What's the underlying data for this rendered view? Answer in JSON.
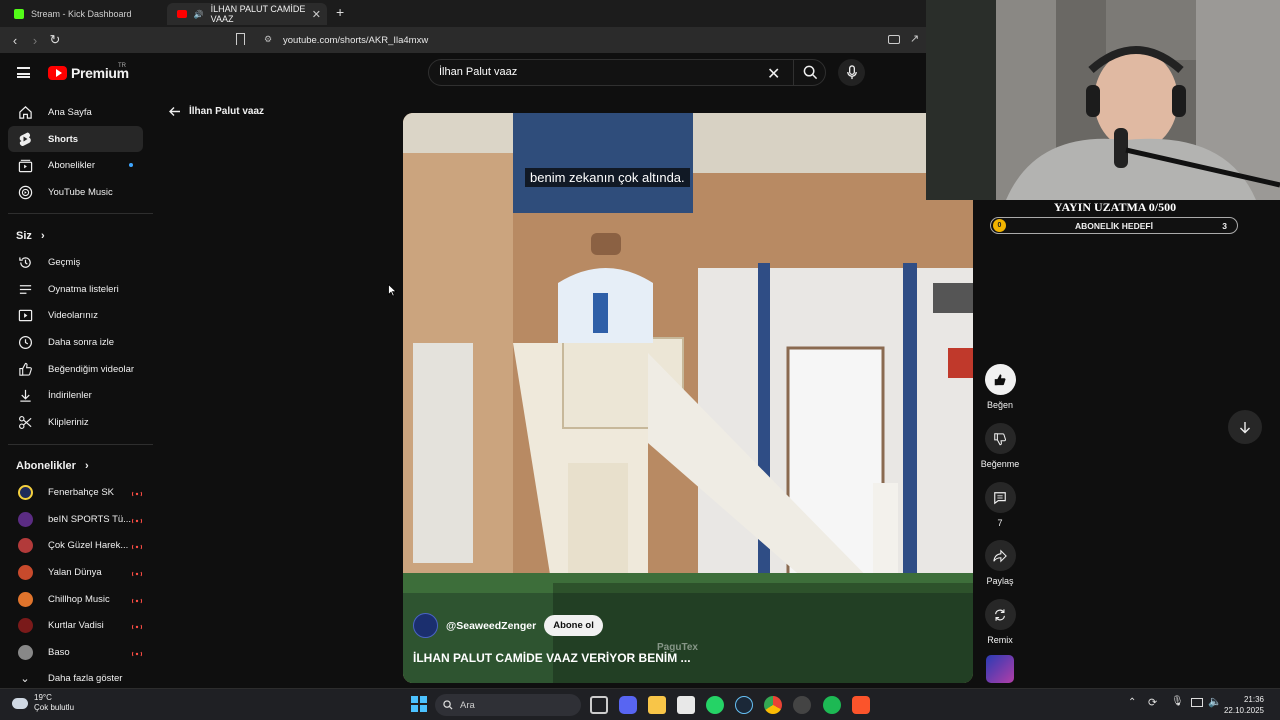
{
  "browser": {
    "tabs": [
      {
        "title": "Stream - Kick Dashboard",
        "active": false
      },
      {
        "title": "İLHAN PALUT CAMİDE VAAZ",
        "active": true
      }
    ],
    "url": "youtube.com/shorts/AKR_Ila4mxw"
  },
  "header": {
    "brand": "Premium",
    "brand_sup": "TR",
    "search_value": "İlhan Palut vaaz"
  },
  "sidebar": {
    "main": [
      {
        "label": "Ana Sayfa",
        "icon": "home-icon"
      },
      {
        "label": "Shorts",
        "icon": "shorts-icon",
        "active": true
      },
      {
        "label": "Abonelikler",
        "icon": "subscriptions-icon"
      },
      {
        "label": "YouTube Music",
        "icon": "music-icon"
      }
    ],
    "you_title": "Siz",
    "you": [
      {
        "label": "Geçmiş",
        "icon": "history-icon"
      },
      {
        "label": "Oynatma listeleri",
        "icon": "playlist-icon"
      },
      {
        "label": "Videolarınız",
        "icon": "your-videos-icon"
      },
      {
        "label": "Daha sonra izle",
        "icon": "watch-later-icon"
      },
      {
        "label": "Beğendiğim videolar",
        "icon": "liked-icon"
      },
      {
        "label": "İndirilenler",
        "icon": "download-icon"
      },
      {
        "label": "Klipleriniz",
        "icon": "scissors-icon"
      }
    ],
    "subs_title": "Abonelikler",
    "subs": [
      {
        "label": "Fenerbahçe SK",
        "color": "#1e2a5a"
      },
      {
        "label": "beIN SPORTS Tü...",
        "color": "#5b2c83"
      },
      {
        "label": "Çok Güzel Harek...",
        "color": "#b23a3a"
      },
      {
        "label": "Yalan Dünya",
        "color": "#c84a2c"
      },
      {
        "label": "Chillhop Music",
        "color": "#e0742c"
      },
      {
        "label": "Kurtlar Vadisi",
        "color": "#7a1a1a"
      },
      {
        "label": "Baso",
        "color": "#888888"
      }
    ],
    "show_more": "Daha fazla göster"
  },
  "back_label": "İlhan Palut vaaz",
  "video": {
    "subtitle": "benim zekanın çok altında.",
    "channel": "@SeaweedZenger",
    "subscribe": "Abone ol",
    "title": "İLHAN PALUT CAMİDE VAAZ VERİYOR BENİM ...",
    "watermark": "PaguTex"
  },
  "actions": {
    "like": "Beğen",
    "dislike": "Beğenme",
    "comments": "7",
    "share": "Paylaş",
    "remix": "Remix"
  },
  "overlay": {
    "title": "YAYIN UZATMA 0/500",
    "goal_label": "ABONELİK HEDEFİ",
    "goal_current": "0",
    "goal_target": "3"
  },
  "taskbar": {
    "temp": "19°C",
    "weather": "Çok bulutlu",
    "search": "Ara",
    "time": "21:36",
    "date": "22.10.2025"
  }
}
